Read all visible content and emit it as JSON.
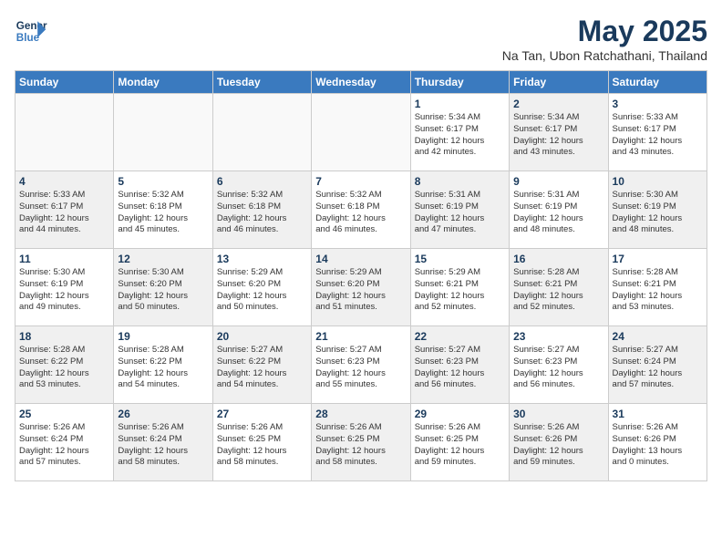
{
  "logo": {
    "line1": "General",
    "line2": "Blue"
  },
  "title": {
    "month_year": "May 2025",
    "location": "Na Tan, Ubon Ratchathani, Thailand"
  },
  "headers": [
    "Sunday",
    "Monday",
    "Tuesday",
    "Wednesday",
    "Thursday",
    "Friday",
    "Saturday"
  ],
  "weeks": [
    [
      {
        "day": "",
        "info": "",
        "shade": "empty"
      },
      {
        "day": "",
        "info": "",
        "shade": "empty"
      },
      {
        "day": "",
        "info": "",
        "shade": "empty"
      },
      {
        "day": "",
        "info": "",
        "shade": "empty"
      },
      {
        "day": "1",
        "info": "Sunrise: 5:34 AM\nSunset: 6:17 PM\nDaylight: 12 hours\nand 42 minutes.",
        "shade": ""
      },
      {
        "day": "2",
        "info": "Sunrise: 5:34 AM\nSunset: 6:17 PM\nDaylight: 12 hours\nand 43 minutes.",
        "shade": "shaded"
      },
      {
        "day": "3",
        "info": "Sunrise: 5:33 AM\nSunset: 6:17 PM\nDaylight: 12 hours\nand 43 minutes.",
        "shade": ""
      }
    ],
    [
      {
        "day": "4",
        "info": "Sunrise: 5:33 AM\nSunset: 6:17 PM\nDaylight: 12 hours\nand 44 minutes.",
        "shade": "shaded"
      },
      {
        "day": "5",
        "info": "Sunrise: 5:32 AM\nSunset: 6:18 PM\nDaylight: 12 hours\nand 45 minutes.",
        "shade": ""
      },
      {
        "day": "6",
        "info": "Sunrise: 5:32 AM\nSunset: 6:18 PM\nDaylight: 12 hours\nand 46 minutes.",
        "shade": "shaded"
      },
      {
        "day": "7",
        "info": "Sunrise: 5:32 AM\nSunset: 6:18 PM\nDaylight: 12 hours\nand 46 minutes.",
        "shade": ""
      },
      {
        "day": "8",
        "info": "Sunrise: 5:31 AM\nSunset: 6:19 PM\nDaylight: 12 hours\nand 47 minutes.",
        "shade": "shaded"
      },
      {
        "day": "9",
        "info": "Sunrise: 5:31 AM\nSunset: 6:19 PM\nDaylight: 12 hours\nand 48 minutes.",
        "shade": ""
      },
      {
        "day": "10",
        "info": "Sunrise: 5:30 AM\nSunset: 6:19 PM\nDaylight: 12 hours\nand 48 minutes.",
        "shade": "shaded"
      }
    ],
    [
      {
        "day": "11",
        "info": "Sunrise: 5:30 AM\nSunset: 6:19 PM\nDaylight: 12 hours\nand 49 minutes.",
        "shade": ""
      },
      {
        "day": "12",
        "info": "Sunrise: 5:30 AM\nSunset: 6:20 PM\nDaylight: 12 hours\nand 50 minutes.",
        "shade": "shaded"
      },
      {
        "day": "13",
        "info": "Sunrise: 5:29 AM\nSunset: 6:20 PM\nDaylight: 12 hours\nand 50 minutes.",
        "shade": ""
      },
      {
        "day": "14",
        "info": "Sunrise: 5:29 AM\nSunset: 6:20 PM\nDaylight: 12 hours\nand 51 minutes.",
        "shade": "shaded"
      },
      {
        "day": "15",
        "info": "Sunrise: 5:29 AM\nSunset: 6:21 PM\nDaylight: 12 hours\nand 52 minutes.",
        "shade": ""
      },
      {
        "day": "16",
        "info": "Sunrise: 5:28 AM\nSunset: 6:21 PM\nDaylight: 12 hours\nand 52 minutes.",
        "shade": "shaded"
      },
      {
        "day": "17",
        "info": "Sunrise: 5:28 AM\nSunset: 6:21 PM\nDaylight: 12 hours\nand 53 minutes.",
        "shade": ""
      }
    ],
    [
      {
        "day": "18",
        "info": "Sunrise: 5:28 AM\nSunset: 6:22 PM\nDaylight: 12 hours\nand 53 minutes.",
        "shade": "shaded"
      },
      {
        "day": "19",
        "info": "Sunrise: 5:28 AM\nSunset: 6:22 PM\nDaylight: 12 hours\nand 54 minutes.",
        "shade": ""
      },
      {
        "day": "20",
        "info": "Sunrise: 5:27 AM\nSunset: 6:22 PM\nDaylight: 12 hours\nand 54 minutes.",
        "shade": "shaded"
      },
      {
        "day": "21",
        "info": "Sunrise: 5:27 AM\nSunset: 6:23 PM\nDaylight: 12 hours\nand 55 minutes.",
        "shade": ""
      },
      {
        "day": "22",
        "info": "Sunrise: 5:27 AM\nSunset: 6:23 PM\nDaylight: 12 hours\nand 56 minutes.",
        "shade": "shaded"
      },
      {
        "day": "23",
        "info": "Sunrise: 5:27 AM\nSunset: 6:23 PM\nDaylight: 12 hours\nand 56 minutes.",
        "shade": ""
      },
      {
        "day": "24",
        "info": "Sunrise: 5:27 AM\nSunset: 6:24 PM\nDaylight: 12 hours\nand 57 minutes.",
        "shade": "shaded"
      }
    ],
    [
      {
        "day": "25",
        "info": "Sunrise: 5:26 AM\nSunset: 6:24 PM\nDaylight: 12 hours\nand 57 minutes.",
        "shade": ""
      },
      {
        "day": "26",
        "info": "Sunrise: 5:26 AM\nSunset: 6:24 PM\nDaylight: 12 hours\nand 58 minutes.",
        "shade": "shaded"
      },
      {
        "day": "27",
        "info": "Sunrise: 5:26 AM\nSunset: 6:25 PM\nDaylight: 12 hours\nand 58 minutes.",
        "shade": ""
      },
      {
        "day": "28",
        "info": "Sunrise: 5:26 AM\nSunset: 6:25 PM\nDaylight: 12 hours\nand 58 minutes.",
        "shade": "shaded"
      },
      {
        "day": "29",
        "info": "Sunrise: 5:26 AM\nSunset: 6:25 PM\nDaylight: 12 hours\nand 59 minutes.",
        "shade": ""
      },
      {
        "day": "30",
        "info": "Sunrise: 5:26 AM\nSunset: 6:26 PM\nDaylight: 12 hours\nand 59 minutes.",
        "shade": "shaded"
      },
      {
        "day": "31",
        "info": "Sunrise: 5:26 AM\nSunset: 6:26 PM\nDaylight: 13 hours\nand 0 minutes.",
        "shade": ""
      }
    ]
  ]
}
